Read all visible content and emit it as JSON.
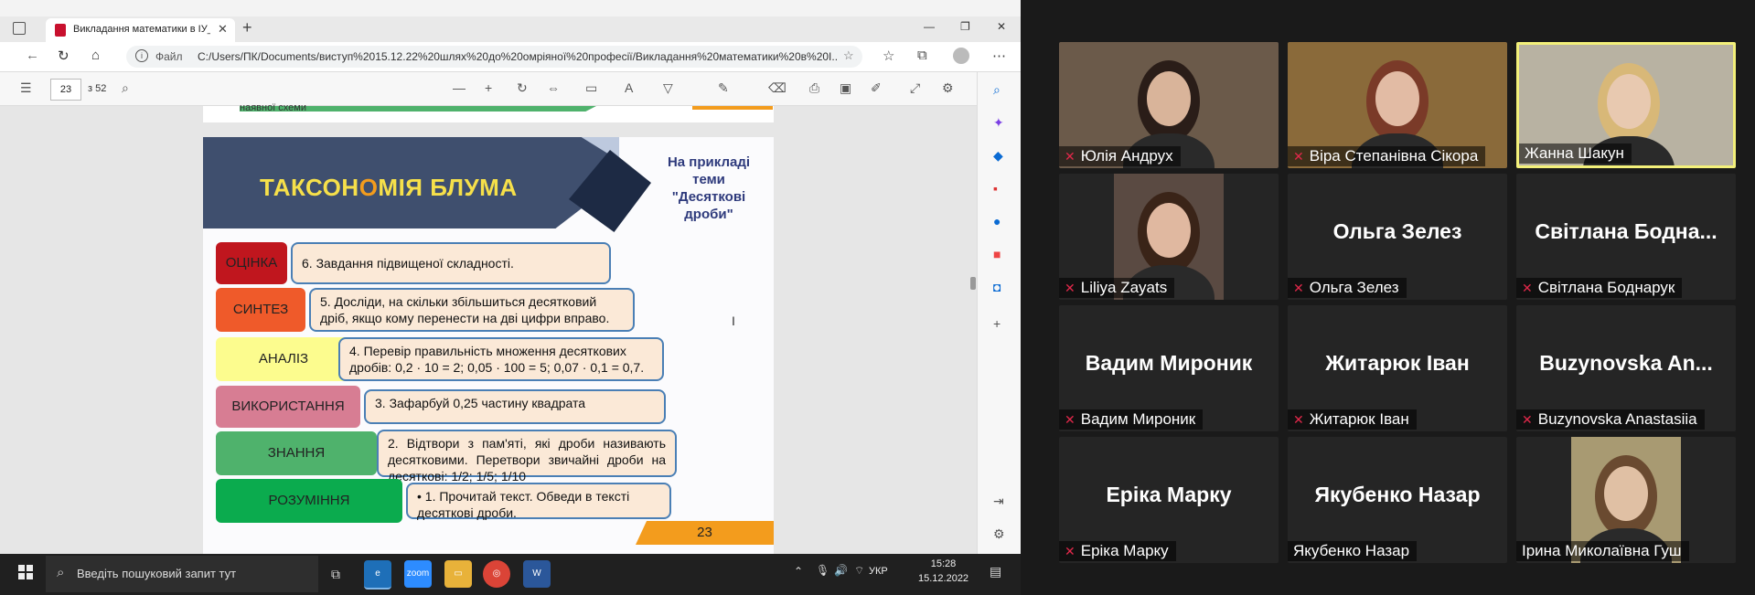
{
  "browser": {
    "tab_title": "Викладання математики в ІУ_Д",
    "file_label": "Файл",
    "url": "C:/Users/ПК/Documents/виступ%2015.12.22%20шлях%20до%20омріяної%20професії/Викладання%20математики%20в%20І...",
    "page_current": "23",
    "page_total": "з 52"
  },
  "slide": {
    "prev_text": "наявної схеми",
    "title_before": "ТАКСОН",
    "title_accent": "О",
    "title_after": "МІЯ БЛУМА",
    "example": "На прикладі теми \"Десяткові дроби\"",
    "levels": [
      {
        "label": "ОЦІНКА",
        "task": "6. Завдання підвищеної складності.",
        "color": "#c0161e"
      },
      {
        "label": "СИНТЕЗ",
        "task": "5. Досліди, на скільки збільшиться десятковий дріб, якщо кому перенести на дві цифри вправо.",
        "color": "#ef5a2a"
      },
      {
        "label": "АНАЛІЗ",
        "task": "4. Перевір правильність множення десяткових дробів: 0,2 · 10 = 2;  0,05  · 100 = 5;   0,07 · 0,1 = 0,7.",
        "color": "#fcfc8e"
      },
      {
        "label": "ВИКОРИСТАННЯ",
        "task": "3. Зафарбуй 0,25 частину квадрата",
        "color": "#d77d93"
      },
      {
        "label": "ЗНАННЯ",
        "task": "2. Відтвори з пам'яті, які дроби називають десятковими. Перетвори звичайні дроби на десяткові: 1/2; 1/5; 1/10",
        "color": "#4fb26c"
      },
      {
        "label": "РОЗУМІННЯ",
        "task": "• 1. Прочитай текст. Обведи в тексті десяткові дроби.",
        "color": "#0bab4e"
      }
    ],
    "page_number": "23"
  },
  "taskbar": {
    "search_placeholder": "Введіть пошуковий запит тут",
    "lang": "УКР",
    "time": "15:28",
    "date": "15.12.2022"
  },
  "participants": [
    {
      "caption": "Юлія Андрух",
      "big": "",
      "muted": true
    },
    {
      "caption": "Віра Степанівна Сікора",
      "big": "",
      "muted": true
    },
    {
      "caption": "Жанна Шакун",
      "big": "",
      "muted": false
    },
    {
      "caption": "Liliya Zayats",
      "big": "",
      "muted": true
    },
    {
      "caption": "Ольга Зелез",
      "big": "Ольга Зелез",
      "muted": true
    },
    {
      "caption": "Світлана Боднарук",
      "big": "Світлана  Бодна...",
      "muted": true
    },
    {
      "caption": "Вадим Мироник",
      "big": "Вадим Мироник",
      "muted": true
    },
    {
      "caption": "Житарюк Іван",
      "big": "Житарюк Іван",
      "muted": true
    },
    {
      "caption": "Buzynovska Anastasiia",
      "big": "Buzynovska  An...",
      "muted": true
    },
    {
      "caption": "Еріка Марку",
      "big": "Еріка Марку",
      "muted": true
    },
    {
      "caption": "Якубенко  Назар",
      "big": "Якубенко  Назар",
      "muted": false
    },
    {
      "caption": "Ірина Миколаївна Гуш",
      "big": "",
      "muted": false
    }
  ]
}
